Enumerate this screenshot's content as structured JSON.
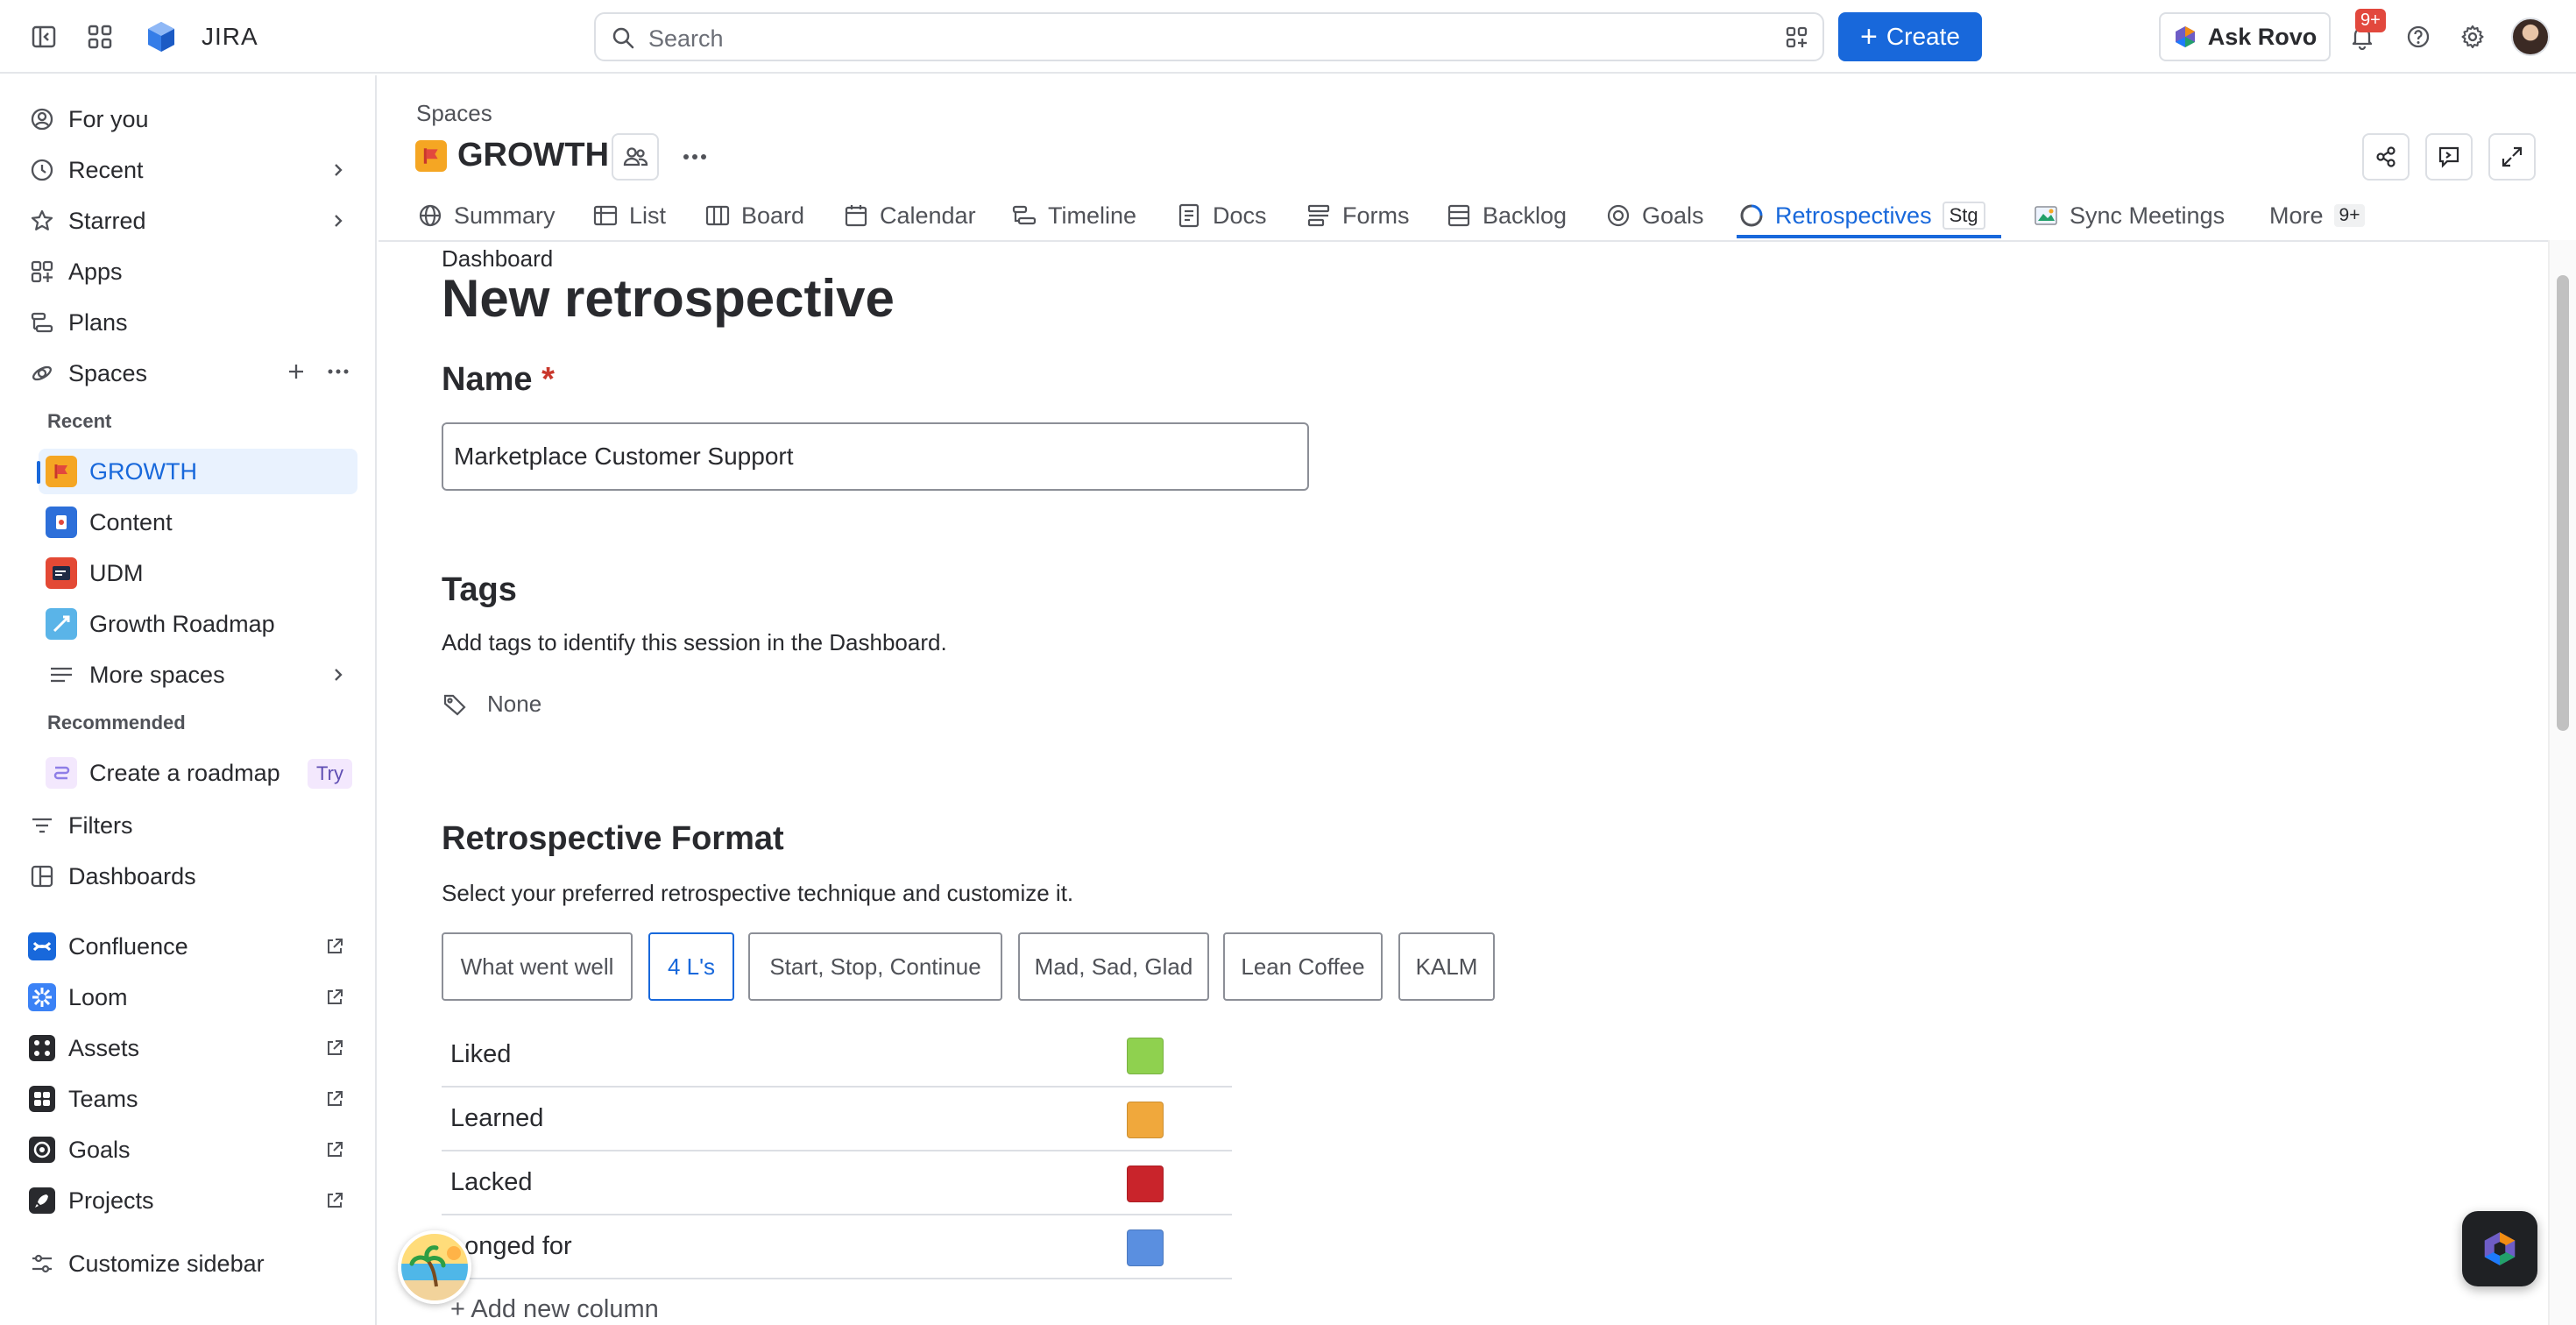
{
  "topbar": {
    "app_name": "JIRA",
    "search_placeholder": "Search",
    "create_label": "Create",
    "ask_rovo_label": "Ask Rovo",
    "notifications_count": "9+"
  },
  "sidebar": {
    "items": [
      {
        "label": "For you",
        "icon": "user-circle-icon"
      },
      {
        "label": "Recent",
        "icon": "clock-icon"
      },
      {
        "label": "Starred",
        "icon": "star-icon"
      },
      {
        "label": "Apps",
        "icon": "apps-grid-icon"
      },
      {
        "label": "Plans",
        "icon": "plans-icon"
      },
      {
        "label": "Spaces",
        "icon": "spaces-icon"
      }
    ],
    "recent_label": "Recent",
    "spaces": [
      {
        "label": "GROWTH",
        "color": "#f5a623"
      },
      {
        "label": "Content",
        "color": "#2d6fd9"
      },
      {
        "label": "UDM",
        "color": "#e34935"
      },
      {
        "label": "Growth Roadmap",
        "color": "#5ab4e8"
      }
    ],
    "more_spaces_label": "More spaces",
    "recommended_label": "Recommended",
    "create_roadmap_label": "Create a roadmap",
    "try_label": "Try",
    "filters_label": "Filters",
    "dashboards_label": "Dashboards",
    "apps": [
      {
        "label": "Confluence",
        "color": "#1868db"
      },
      {
        "label": "Loom",
        "color": "#3b82f6"
      },
      {
        "label": "Assets",
        "color": "#292a2e"
      },
      {
        "label": "Teams",
        "color": "#292a2e"
      },
      {
        "label": "Goals",
        "color": "#292a2e"
      },
      {
        "label": "Projects",
        "color": "#292a2e"
      }
    ],
    "customize_label": "Customize sidebar"
  },
  "header": {
    "breadcrumb": "Spaces",
    "space_name": "GROWTH"
  },
  "tabs": [
    {
      "label": "Summary"
    },
    {
      "label": "List"
    },
    {
      "label": "Board"
    },
    {
      "label": "Calendar"
    },
    {
      "label": "Timeline"
    },
    {
      "label": "Docs"
    },
    {
      "label": "Forms"
    },
    {
      "label": "Backlog"
    },
    {
      "label": "Goals"
    },
    {
      "label": "Retrospectives",
      "badge": "Stg"
    },
    {
      "label": "Sync Meetings"
    },
    {
      "label": "More",
      "badge": "9+"
    }
  ],
  "form": {
    "breadcrumb": "Dashboard",
    "title": "New retrospective",
    "name_heading": "Name",
    "required_mark": "*",
    "name_value": "Marketplace Customer Support",
    "tags_heading": "Tags",
    "tags_desc": "Add tags to identify this session in the Dashboard.",
    "tags_value": "None",
    "format_heading": "Retrospective Format",
    "format_desc": "Select your preferred retrospective technique and customize it.",
    "formats": [
      "What went well",
      "4 L's",
      "Start, Stop, Continue",
      "Mad, Sad, Glad",
      "Lean Coffee",
      "KALM"
    ],
    "selected_format": "4 L's",
    "columns": [
      {
        "label": "Liked",
        "color": "#8fd14f"
      },
      {
        "label": "Learned",
        "color": "#f0a83c"
      },
      {
        "label": "Lacked",
        "color": "#c9242b"
      },
      {
        "label": "Longed for",
        "color": "#5a8fe0"
      }
    ],
    "add_column_label": "+ Add new column"
  }
}
